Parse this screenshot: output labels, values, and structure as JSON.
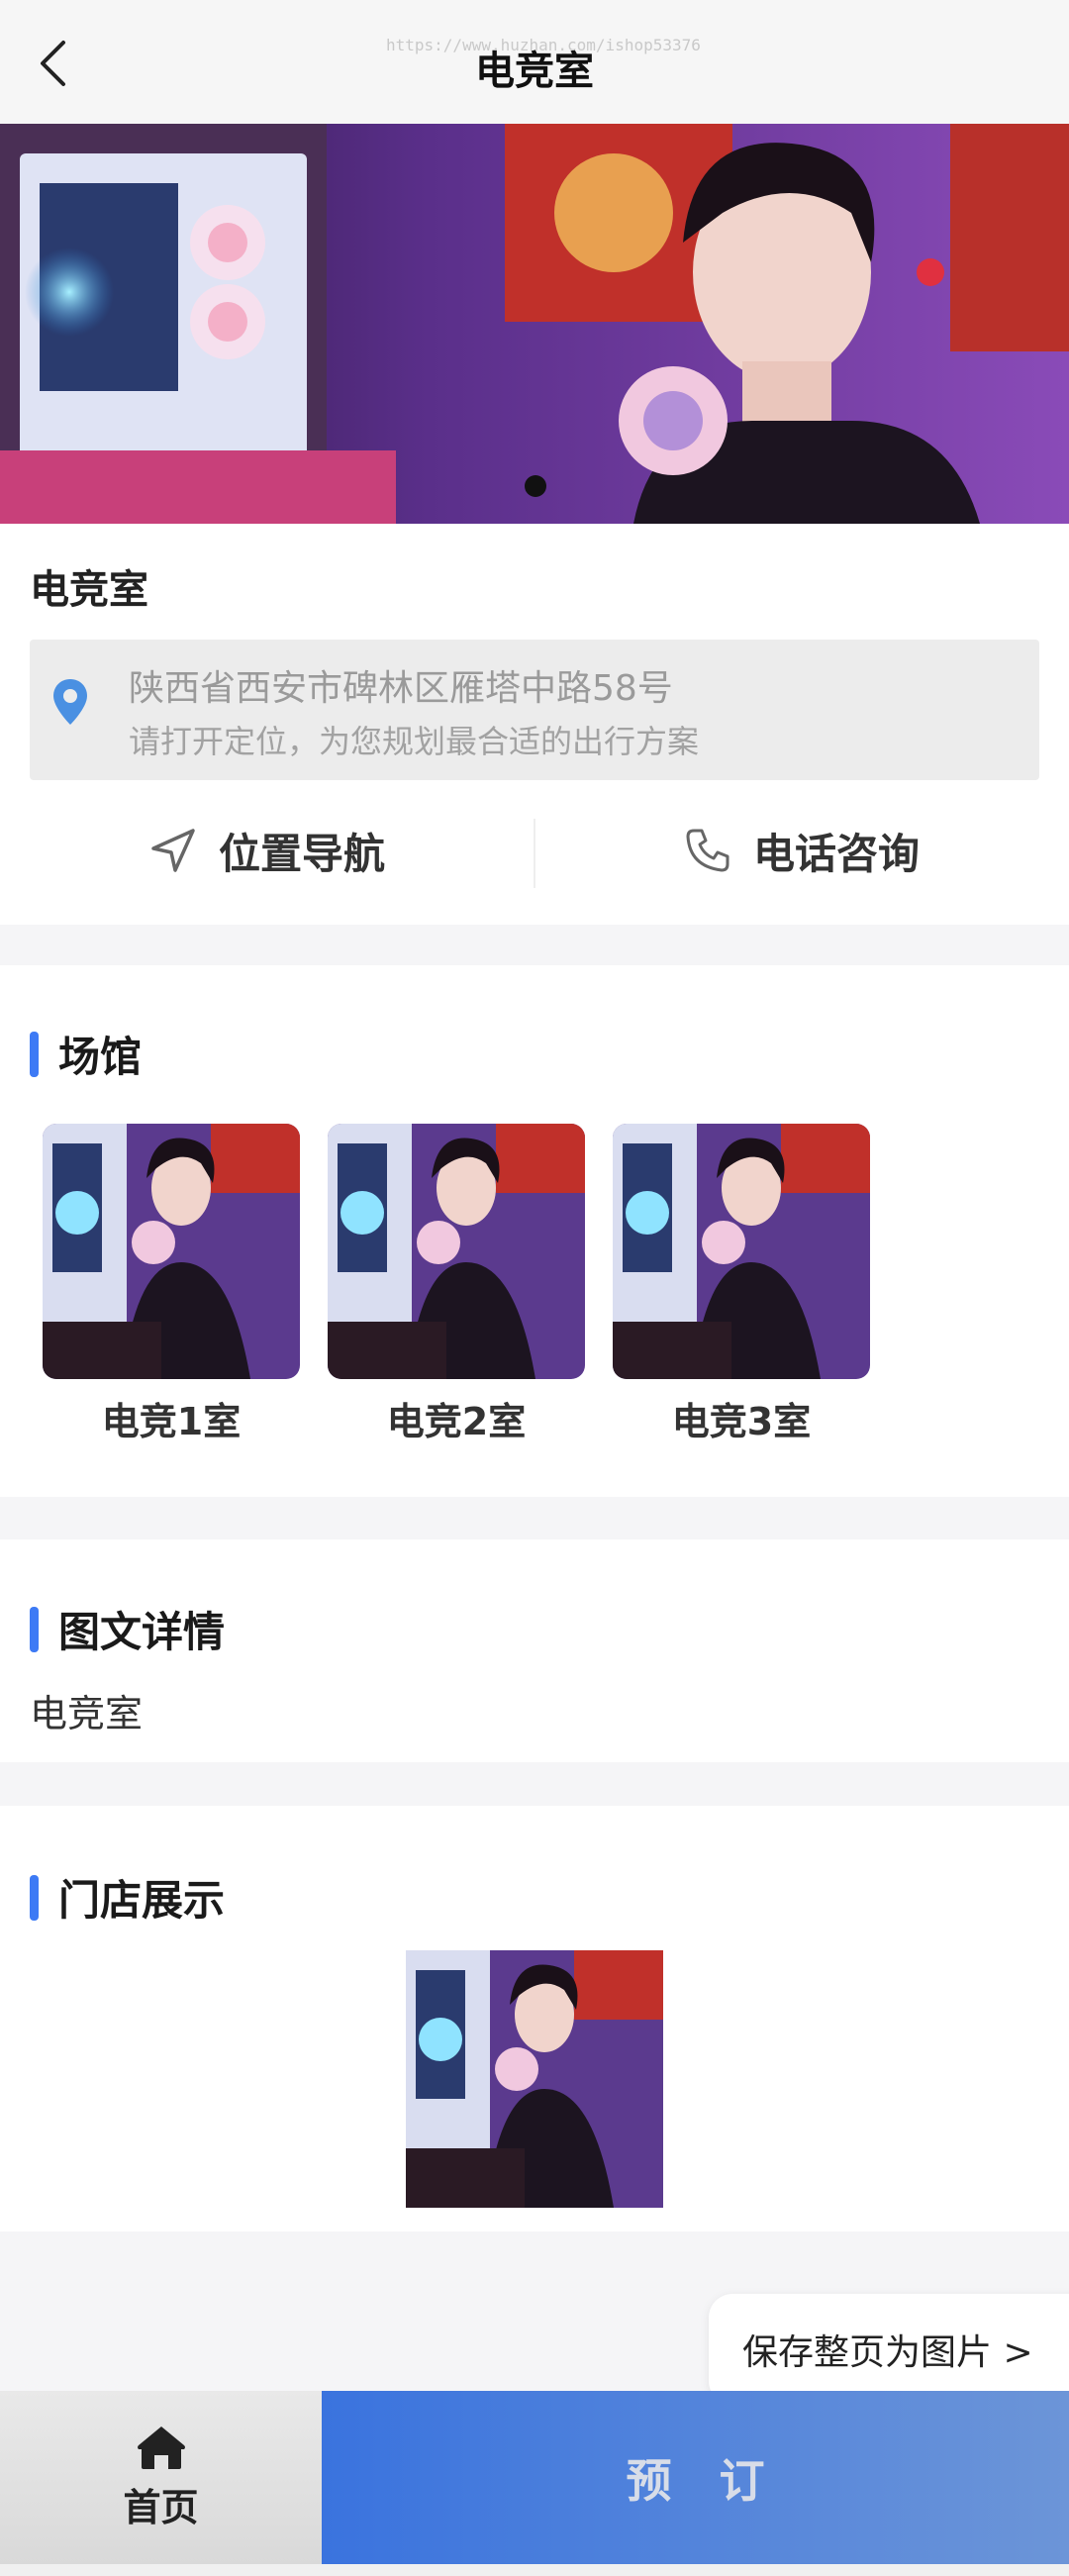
{
  "header": {
    "title": "电竞室",
    "watermark": "https://www.huzhan.com/ishop53376"
  },
  "banner": {
    "slide_count": 1,
    "active_slide": 1
  },
  "store": {
    "name": "电竞室",
    "address": "陕西省西安市碑林区雁塔中路58号",
    "location_hint": "请打开定位，为您规划最合适的出行方案",
    "nav_label": "位置导航",
    "phone_label": "电话咨询"
  },
  "venues": {
    "title": "场馆",
    "items": [
      {
        "name": "电竞1室"
      },
      {
        "name": "电竞2室"
      },
      {
        "name": "电竞3室"
      }
    ]
  },
  "details": {
    "title": "图文详情",
    "text": "电竞室"
  },
  "showcase": {
    "title": "门店展示"
  },
  "footer": {
    "save_label": "保存整页为图片 >",
    "home_label": "首页",
    "book_label": "预订"
  },
  "colors": {
    "accent": "#3d7af5",
    "book_gradient_start": "#3a73de",
    "book_gradient_end": "#6c95d8"
  }
}
